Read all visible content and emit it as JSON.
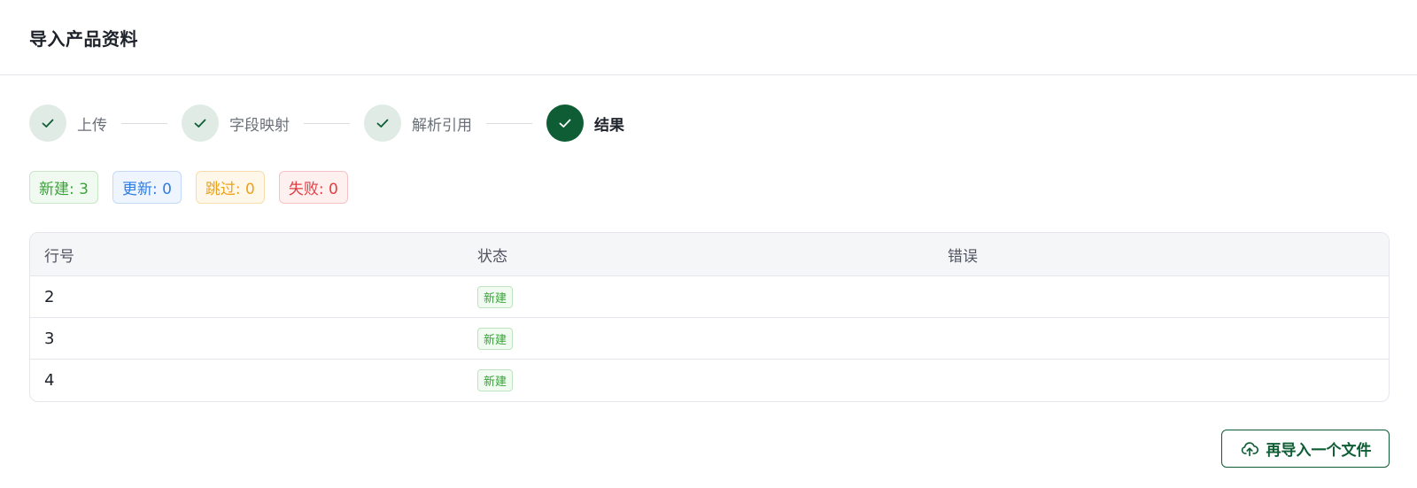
{
  "page": {
    "title": "导入产品资料"
  },
  "steps": [
    {
      "label": "上传",
      "state": "done"
    },
    {
      "label": "字段映射",
      "state": "done"
    },
    {
      "label": "解析引用",
      "state": "done"
    },
    {
      "label": "结果",
      "state": "active"
    }
  ],
  "summary": {
    "created": "新建: 3",
    "updated": "更新: 0",
    "skipped": "跳过: 0",
    "failed": "失败: 0"
  },
  "table": {
    "columns": [
      "行号",
      "状态",
      "错误"
    ],
    "rows": [
      {
        "row": "2",
        "status": "新建",
        "error": ""
      },
      {
        "row": "3",
        "status": "新建",
        "error": ""
      },
      {
        "row": "4",
        "status": "新建",
        "error": ""
      }
    ]
  },
  "actions": {
    "reimport_label": "再导入一个文件"
  },
  "colors": {
    "primary": "#0e5d35",
    "step_done_bg": "#dfebe4",
    "success": "#3aa33a",
    "info": "#2f7de1",
    "warning": "#eca11a",
    "danger": "#e23b3f"
  },
  "icons": {
    "step_done": "check-icon",
    "reimport": "cloud-upload-icon"
  }
}
